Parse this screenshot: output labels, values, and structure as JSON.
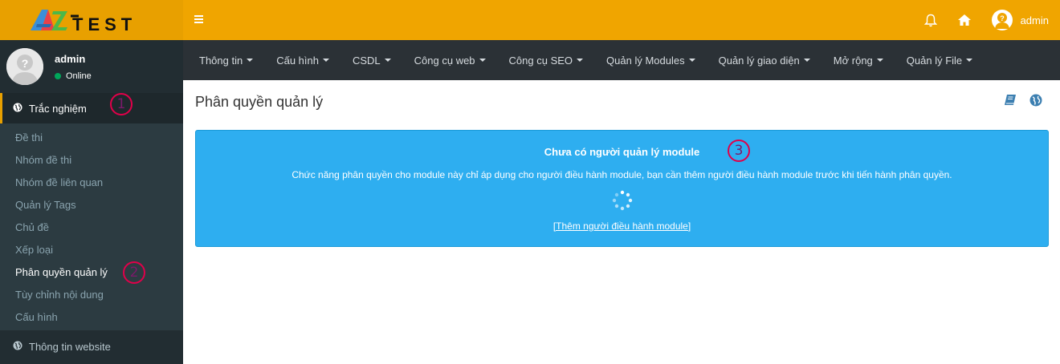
{
  "brand": {
    "logo_az": "AZ",
    "logo_text": "TEST",
    "primary": "#f0a500",
    "sidebar_bg": "#222d32"
  },
  "user": {
    "name": "admin",
    "status": "Online"
  },
  "sidebar": {
    "active_section": {
      "icon": "globe-icon",
      "label": "Trắc nghiệm"
    },
    "items": [
      {
        "label": "Đề thi"
      },
      {
        "label": "Nhóm đề thi"
      },
      {
        "label": "Nhóm đề liên quan"
      },
      {
        "label": "Quản lý Tags"
      },
      {
        "label": "Chủ đề"
      },
      {
        "label": "Xếp loại"
      },
      {
        "label": "Phân quyền quản lý",
        "active": true
      },
      {
        "label": "Tùy chỉnh nội dung"
      },
      {
        "label": "Cấu hình"
      }
    ],
    "footer_section": {
      "icon": "globe-icon",
      "label": "Thông tin website"
    }
  },
  "topbar": {
    "menu_icon": "hamburger-icon",
    "user_name": "admin"
  },
  "nav": {
    "items": [
      {
        "label": "Thông tin"
      },
      {
        "label": "Cấu hình"
      },
      {
        "label": "CSDL"
      },
      {
        "label": "Công cụ web"
      },
      {
        "label": "Công cụ SEO"
      },
      {
        "label": "Quản lý Modules"
      },
      {
        "label": "Quản lý giao diện"
      },
      {
        "label": "Mở rộng"
      },
      {
        "label": "Quản lý File"
      }
    ]
  },
  "page": {
    "title": "Phân quyền quản lý"
  },
  "notice": {
    "title": "Chưa có người quản lý module",
    "text": "Chức năng phân quyền cho module này chỉ áp dụng cho người điều hành module, bạn cần thêm người điều hành module trước khi tiến hành phân quyền.",
    "link": "[Thêm người điều hành module]",
    "color": "#2eaef0"
  },
  "annotations": {
    "one": "1",
    "two": "2",
    "three": "3"
  }
}
